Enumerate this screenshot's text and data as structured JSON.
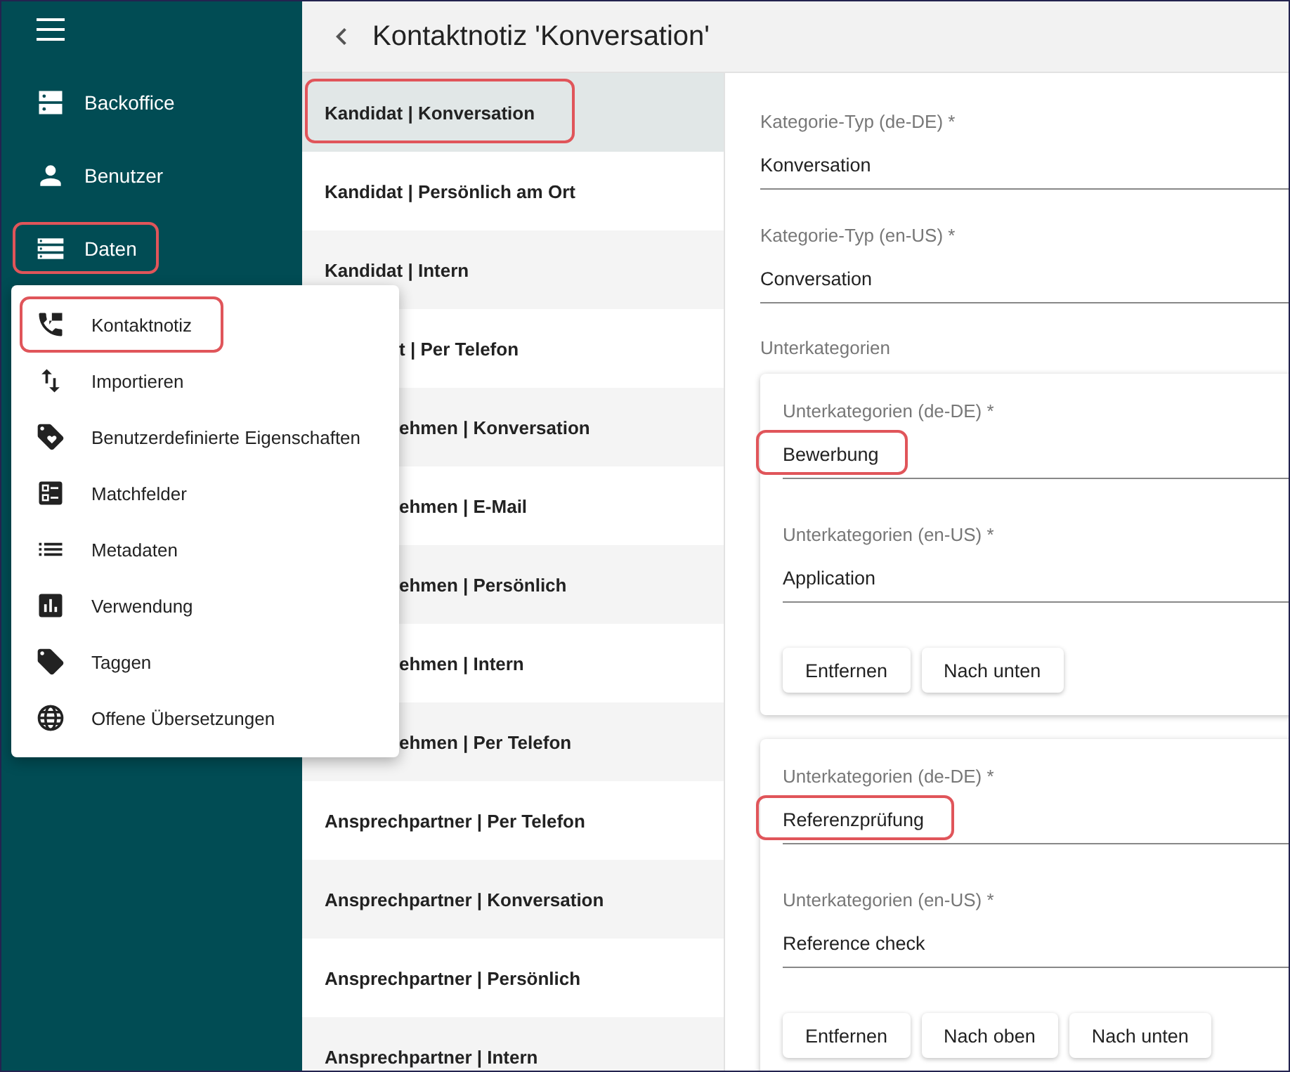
{
  "sidebar": {
    "items": [
      {
        "label": "Backoffice",
        "highlighted": false
      },
      {
        "label": "Benutzer",
        "highlighted": false
      },
      {
        "label": "Daten",
        "highlighted": true
      }
    ]
  },
  "header": {
    "title": "Kontaktnotiz 'Konversation'"
  },
  "list": {
    "items": [
      {
        "label": "Kandidat | Konversation",
        "selected": true,
        "highlighted": true,
        "covered": false
      },
      {
        "label": "Kandidat | Persönlich am Ort",
        "selected": false,
        "highlighted": false,
        "covered": false
      },
      {
        "label": "Kandidat | Intern",
        "selected": false,
        "highlighted": false,
        "covered": false
      },
      {
        "label": "t | Per Telefon",
        "selected": false,
        "highlighted": false,
        "covered": true
      },
      {
        "label": "ehmen | Konversation",
        "selected": false,
        "highlighted": false,
        "covered": true
      },
      {
        "label": "ehmen | E-Mail",
        "selected": false,
        "highlighted": false,
        "covered": true
      },
      {
        "label": "ehmen | Persönlich",
        "selected": false,
        "highlighted": false,
        "covered": true
      },
      {
        "label": "ehmen | Intern",
        "selected": false,
        "highlighted": false,
        "covered": true
      },
      {
        "label": "ehmen | Per Telefon",
        "selected": false,
        "highlighted": false,
        "covered": true
      },
      {
        "label": "Ansprechpartner | Per Telefon",
        "selected": false,
        "highlighted": false,
        "covered": false
      },
      {
        "label": "Ansprechpartner | Konversation",
        "selected": false,
        "highlighted": false,
        "covered": false
      },
      {
        "label": "Ansprechpartner | Persönlich",
        "selected": false,
        "highlighted": false,
        "covered": false
      },
      {
        "label": "Ansprechpartner | Intern",
        "selected": false,
        "highlighted": false,
        "covered": false
      }
    ]
  },
  "menu": {
    "items": [
      {
        "label": "Kontaktnotiz",
        "highlighted": true
      },
      {
        "label": "Importieren",
        "highlighted": false
      },
      {
        "label": "Benutzerdefinierte Eigenschaften",
        "highlighted": false
      },
      {
        "label": "Matchfelder",
        "highlighted": false
      },
      {
        "label": "Metadaten",
        "highlighted": false
      },
      {
        "label": "Verwendung",
        "highlighted": false
      },
      {
        "label": "Taggen",
        "highlighted": false
      },
      {
        "label": "Offene Übersetzungen",
        "highlighted": false
      }
    ]
  },
  "form": {
    "fields": [
      {
        "label": "Kategorie-Typ (de-DE) *",
        "value": "Konversation",
        "highlighted": false
      },
      {
        "label": "Kategorie-Typ (en-US) *",
        "value": "Conversation",
        "highlighted": false
      }
    ],
    "section_label": "Unterkategorien",
    "subcategories": [
      {
        "fields": [
          {
            "label": "Unterkategorien (de-DE) *",
            "value": "Bewerbung",
            "highlighted": true
          },
          {
            "label": "Unterkategorien (en-US) *",
            "value": "Application",
            "highlighted": false
          }
        ],
        "buttons": [
          "Entfernen",
          "Nach unten"
        ]
      },
      {
        "fields": [
          {
            "label": "Unterkategorien (de-DE) *",
            "value": "Referenzprüfung",
            "highlighted": true
          },
          {
            "label": "Unterkategorien (en-US) *",
            "value": "Reference check",
            "highlighted": false
          }
        ],
        "buttons": [
          "Entfernen",
          "Nach oben",
          "Nach unten"
        ]
      }
    ]
  }
}
